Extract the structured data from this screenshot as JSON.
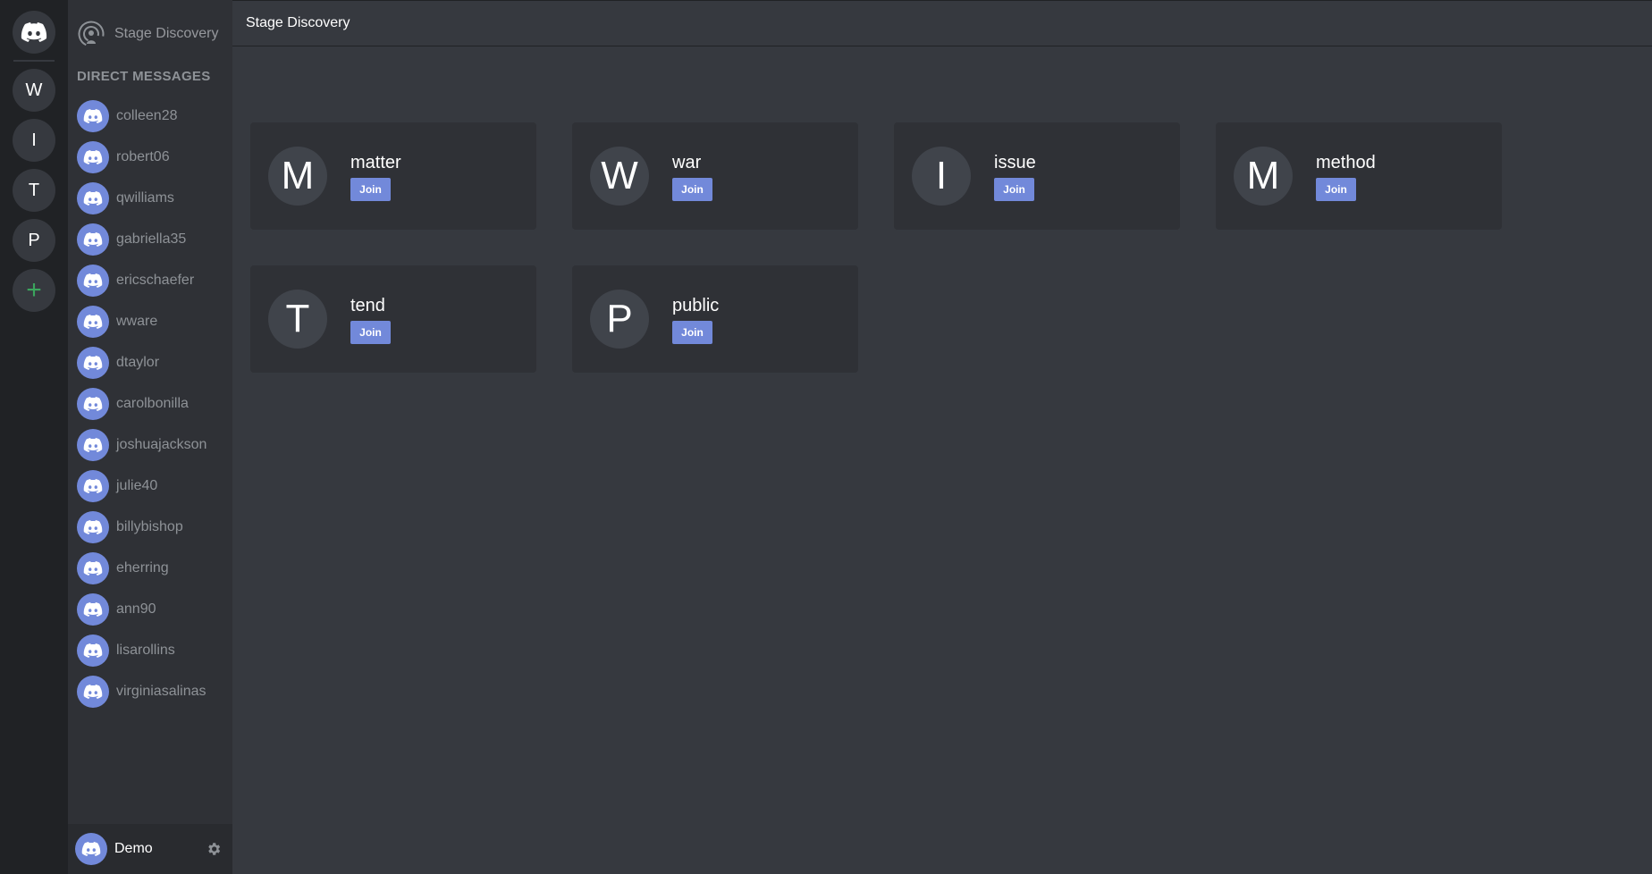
{
  "servers": {
    "home_icon": "discord-logo-icon",
    "items": [
      {
        "letter": "W"
      },
      {
        "letter": "I"
      },
      {
        "letter": "T"
      },
      {
        "letter": "P"
      }
    ],
    "add_icon": "+"
  },
  "sidebar": {
    "stage_discovery_label": "Stage Discovery",
    "dm_heading": "DIRECT MESSAGES",
    "dms": [
      {
        "name": "colleen28"
      },
      {
        "name": "robert06"
      },
      {
        "name": "qwilliams"
      },
      {
        "name": "gabriella35"
      },
      {
        "name": "ericschaefer"
      },
      {
        "name": "wware"
      },
      {
        "name": "dtaylor"
      },
      {
        "name": "carolbonilla"
      },
      {
        "name": "joshuajackson"
      },
      {
        "name": "julie40"
      },
      {
        "name": "billybishop"
      },
      {
        "name": "eherring"
      },
      {
        "name": "ann90"
      },
      {
        "name": "lisarollins"
      },
      {
        "name": "virginiasalinas"
      }
    ],
    "user": {
      "name": "Demo"
    }
  },
  "header": {
    "title": "Stage Discovery"
  },
  "stages": [
    {
      "letter": "M",
      "name": "matter",
      "join_label": "Join"
    },
    {
      "letter": "W",
      "name": "war",
      "join_label": "Join"
    },
    {
      "letter": "I",
      "name": "issue",
      "join_label": "Join"
    },
    {
      "letter": "M",
      "name": "method",
      "join_label": "Join"
    },
    {
      "letter": "T",
      "name": "tend",
      "join_label": "Join"
    },
    {
      "letter": "P",
      "name": "public",
      "join_label": "Join"
    }
  ],
  "colors": {
    "accent": "#7289da",
    "rail_bg": "#202225",
    "sidebar_bg": "#2f3136",
    "main_bg": "#36393f",
    "add_green": "#3ba55d"
  }
}
